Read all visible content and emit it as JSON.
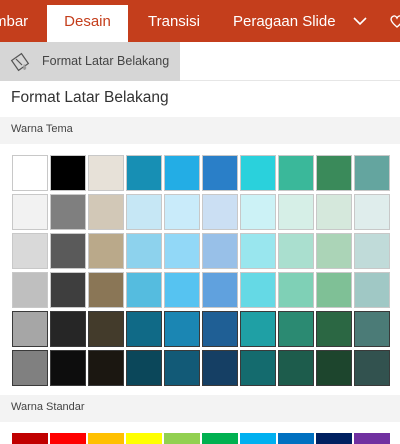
{
  "ribbon": {
    "tabs": [
      {
        "label": "mbar",
        "active": false
      },
      {
        "label": "Desain",
        "active": true
      },
      {
        "label": "Transisi",
        "active": false
      },
      {
        "label": "Peragaan Slide",
        "active": false
      }
    ],
    "more_icon": "chevron-down-icon",
    "extra_icon": "heart-icon",
    "color": "#c43e1c"
  },
  "command": {
    "label": "Format Latar Belakang",
    "icon": "format-background-icon"
  },
  "pane": {
    "title": "Format Latar Belakang"
  },
  "theme_colors": {
    "label": "Warna Tema",
    "rows": [
      [
        "#ffffff",
        "#000000",
        "#e7e1d8",
        "#178fb4",
        "#23ade5",
        "#2a7fc8",
        "#2ad1dc",
        "#3ab89a",
        "#3a8a5a",
        "#64a59f"
      ],
      [
        "#f2f2f2",
        "#7f7f7f",
        "#d2c8b7",
        "#c6e7f5",
        "#c9ebfa",
        "#cbdff3",
        "#ccf2f6",
        "#d6efe7",
        "#d5e8dc",
        "#dfedec"
      ],
      [
        "#d9d9d9",
        "#5a5a5a",
        "#baa98a",
        "#8dd2ed",
        "#92d8f7",
        "#98c0e8",
        "#99e6ee",
        "#aadfcf",
        "#abd4b7",
        "#c0dbd9"
      ],
      [
        "#bfbfbf",
        "#3e3e3e",
        "#8a7656",
        "#55bcdf",
        "#56c3f1",
        "#60a1de",
        "#65d9e5",
        "#7fd0b6",
        "#7fc096",
        "#a0c8c5"
      ],
      [
        "#a6a6a6",
        "#262626",
        "#433b2b",
        "#106a87",
        "#1b86b3",
        "#1f5f95",
        "#1fa0a5",
        "#2b8a72",
        "#2b6743",
        "#4b7b77"
      ],
      [
        "#808080",
        "#0d0d0d",
        "#1b1711",
        "#0b475a",
        "#125a77",
        "#153f64",
        "#146b6e",
        "#1d5c4c",
        "#1d452d",
        "#32524f"
      ]
    ]
  },
  "standard_colors": {
    "label": "Warna Standar",
    "row": [
      "#c00000",
      "#ff0000",
      "#ffc000",
      "#ffff00",
      "#92d050",
      "#00b050",
      "#00b0f0",
      "#0070c0",
      "#002060",
      "#7030a0"
    ]
  }
}
